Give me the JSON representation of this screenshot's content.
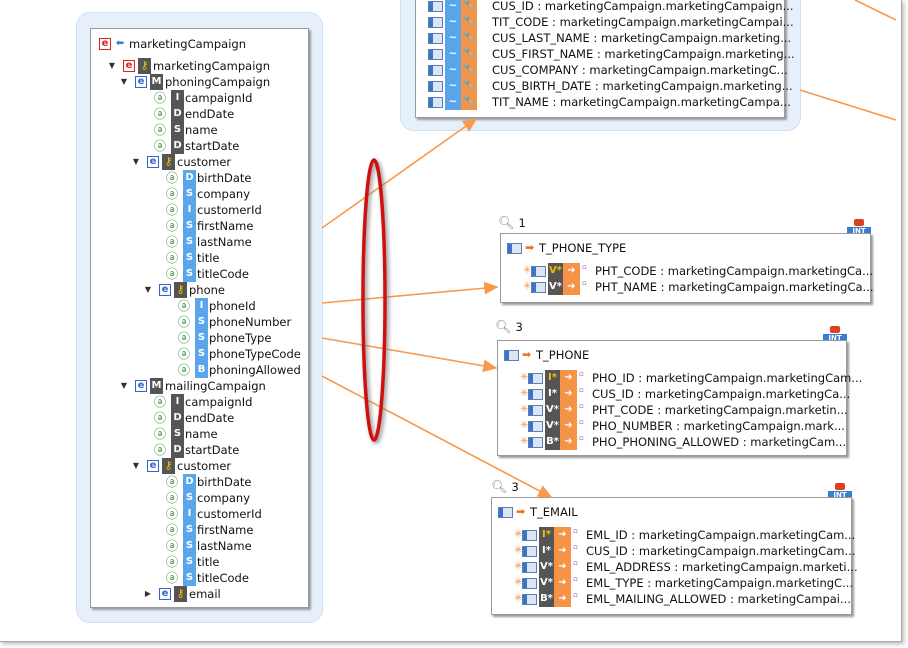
{
  "tree": {
    "title": "marketingCampaign",
    "rows": [
      {
        "lvl": 0,
        "kind": "elem",
        "e": "red",
        "key": true,
        "label": "marketingCampaign",
        "exp": "down"
      },
      {
        "lvl": 1,
        "kind": "elem",
        "e": "blue",
        "badge": "M",
        "label": "phoningCampaign",
        "exp": "down"
      },
      {
        "lvl": 2,
        "kind": "attr",
        "t": "I",
        "c": "dark",
        "label": "campaignId"
      },
      {
        "lvl": 2,
        "kind": "attr",
        "t": "D",
        "c": "dark",
        "label": "endDate"
      },
      {
        "lvl": 2,
        "kind": "attr",
        "t": "S",
        "c": "dark",
        "label": "name"
      },
      {
        "lvl": 2,
        "kind": "attr",
        "t": "D",
        "c": "dark",
        "label": "startDate"
      },
      {
        "lvl": 2,
        "kind": "elem",
        "e": "blue",
        "key": true,
        "label": "customer",
        "exp": "down"
      },
      {
        "lvl": 3,
        "kind": "attr",
        "t": "D",
        "c": "blue",
        "label": "birthDate"
      },
      {
        "lvl": 3,
        "kind": "attr",
        "t": "S",
        "c": "blue",
        "label": "company"
      },
      {
        "lvl": 3,
        "kind": "attr",
        "t": "I",
        "c": "blue",
        "label": "customerId"
      },
      {
        "lvl": 3,
        "kind": "attr",
        "t": "S",
        "c": "blue",
        "label": "firstName"
      },
      {
        "lvl": 3,
        "kind": "attr",
        "t": "S",
        "c": "blue",
        "label": "lastName"
      },
      {
        "lvl": 3,
        "kind": "attr",
        "t": "S",
        "c": "blue",
        "label": "title"
      },
      {
        "lvl": 3,
        "kind": "attr",
        "t": "S",
        "c": "blue",
        "label": "titleCode"
      },
      {
        "lvl": 3,
        "kind": "elem",
        "e": "blue",
        "key": true,
        "label": "phone",
        "exp": "down"
      },
      {
        "lvl": 4,
        "kind": "attr",
        "t": "I",
        "c": "blue",
        "label": "phoneId"
      },
      {
        "lvl": 4,
        "kind": "attr",
        "t": "S",
        "c": "blue",
        "label": "phoneNumber"
      },
      {
        "lvl": 4,
        "kind": "attr",
        "t": "S",
        "c": "blue",
        "label": "phoneType"
      },
      {
        "lvl": 4,
        "kind": "attr",
        "t": "S",
        "c": "blue",
        "label": "phoneTypeCode"
      },
      {
        "lvl": 4,
        "kind": "attr",
        "t": "B",
        "c": "blue",
        "label": "phoningAllowed"
      },
      {
        "lvl": 1,
        "kind": "elem",
        "e": "blue",
        "badge": "M",
        "label": "mailingCampaign",
        "exp": "down"
      },
      {
        "lvl": 2,
        "kind": "attr",
        "t": "I",
        "c": "dark",
        "label": "campaignId"
      },
      {
        "lvl": 2,
        "kind": "attr",
        "t": "D",
        "c": "dark",
        "label": "endDate"
      },
      {
        "lvl": 2,
        "kind": "attr",
        "t": "S",
        "c": "dark",
        "label": "name"
      },
      {
        "lvl": 2,
        "kind": "attr",
        "t": "D",
        "c": "dark",
        "label": "startDate"
      },
      {
        "lvl": 2,
        "kind": "elem",
        "e": "blue",
        "key": true,
        "label": "customer",
        "exp": "down"
      },
      {
        "lvl": 3,
        "kind": "attr",
        "t": "D",
        "c": "blue",
        "label": "birthDate"
      },
      {
        "lvl": 3,
        "kind": "attr",
        "t": "S",
        "c": "blue",
        "label": "company"
      },
      {
        "lvl": 3,
        "kind": "attr",
        "t": "I",
        "c": "blue",
        "label": "customerId"
      },
      {
        "lvl": 3,
        "kind": "attr",
        "t": "S",
        "c": "blue",
        "label": "firstName"
      },
      {
        "lvl": 3,
        "kind": "attr",
        "t": "S",
        "c": "blue",
        "label": "lastName"
      },
      {
        "lvl": 3,
        "kind": "attr",
        "t": "S",
        "c": "blue",
        "label": "title"
      },
      {
        "lvl": 3,
        "kind": "attr",
        "t": "S",
        "c": "blue",
        "label": "titleCode"
      },
      {
        "lvl": 3,
        "kind": "elem",
        "e": "blue",
        "key": true,
        "label": "email",
        "exp": "right"
      }
    ]
  },
  "customer_table": {
    "columns": [
      "CUS_ID : marketingCampaign.marketingCampaign...",
      "TIT_CODE : marketingCampaign.marketingCampai...",
      "CUS_LAST_NAME : marketingCampaign.marketing...",
      "CUS_FIRST_NAME : marketingCampaign.marketing...",
      "CUS_COMPANY : marketingCampaign.marketingC...",
      "CUS_BIRTH_DATE : marketingCampaign.marketing...",
      "TIT_NAME : marketingCampaign.marketingCampa..."
    ]
  },
  "tables": [
    {
      "count": "1",
      "name": "T_PHONE_TYPE",
      "columns": [
        {
          "key": true,
          "t": "V",
          "label": "PHT_CODE : marketingCampaign.marketingCa..."
        },
        {
          "key": false,
          "t": "V",
          "label": "PHT_NAME : marketingCampaign.marketingCa..."
        }
      ]
    },
    {
      "count": "3",
      "name": "T_PHONE",
      "columns": [
        {
          "key": true,
          "t": "I",
          "label": "PHO_ID : marketingCampaign.marketingCam..."
        },
        {
          "key": false,
          "t": "I",
          "label": "CUS_ID : marketingCampaign.marketingCa..."
        },
        {
          "key": false,
          "t": "V",
          "label": "PHT_CODE : marketingCampaign.marketin..."
        },
        {
          "key": false,
          "t": "V",
          "label": "PHO_NUMBER : marketingCampaign.mark..."
        },
        {
          "key": false,
          "t": "B",
          "label": "PHO_PHONING_ALLOWED : marketingCam..."
        }
      ]
    },
    {
      "count": "3",
      "name": "T_EMAIL",
      "columns": [
        {
          "key": true,
          "t": "I",
          "label": "EML_ID : marketingCampaign.marketingCam..."
        },
        {
          "key": false,
          "t": "I",
          "label": "CUS_ID : marketingCampaign.marketingCam..."
        },
        {
          "key": false,
          "t": "V",
          "label": "EML_ADDRESS : marketingCampaign.marketi..."
        },
        {
          "key": false,
          "t": "V",
          "label": "EML_TYPE : marketingCampaign.marketingC..."
        },
        {
          "key": false,
          "t": "B",
          "label": "EML_MAILING_ALLOWED : marketingCampai..."
        }
      ]
    }
  ],
  "colors": {
    "arrow": "#f89a4e",
    "highlight": "#d01010",
    "halo": "#e6f0fb"
  }
}
